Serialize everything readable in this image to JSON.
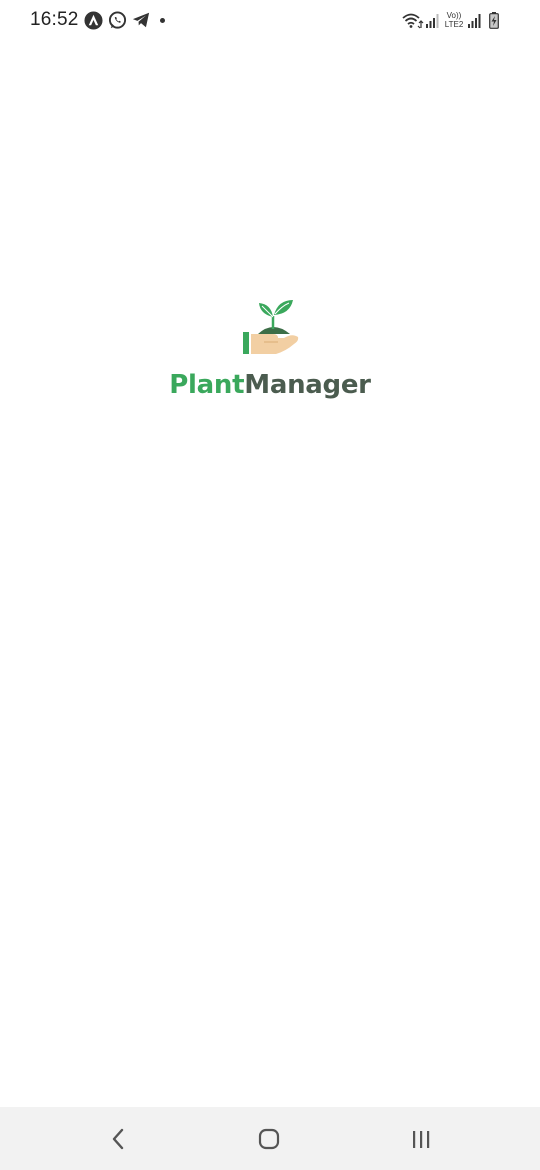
{
  "status_bar": {
    "time": "16:52",
    "notification_icons": [
      "android-auto-icon",
      "whatsapp-icon",
      "telegram-icon",
      "notification-dot"
    ],
    "system_icons": [
      "wifi-icon",
      "signal-icon",
      "volte-lte2-icon",
      "signal-icon",
      "battery-charging-icon"
    ],
    "volte_label": "Vo)) LTE2"
  },
  "splash": {
    "logo_icon": "plant-in-hand-icon",
    "brand_part1": "Plant",
    "brand_part2": "Manager",
    "colors": {
      "brand_green": "#3aa85c",
      "brand_dark": "#4b5c4f",
      "hand": "#f2cfa3",
      "leaf": "#3aa85c",
      "soil": "#3c6e47"
    }
  },
  "nav_bar": {
    "buttons": [
      "back-icon",
      "home-icon",
      "recents-icon"
    ]
  }
}
